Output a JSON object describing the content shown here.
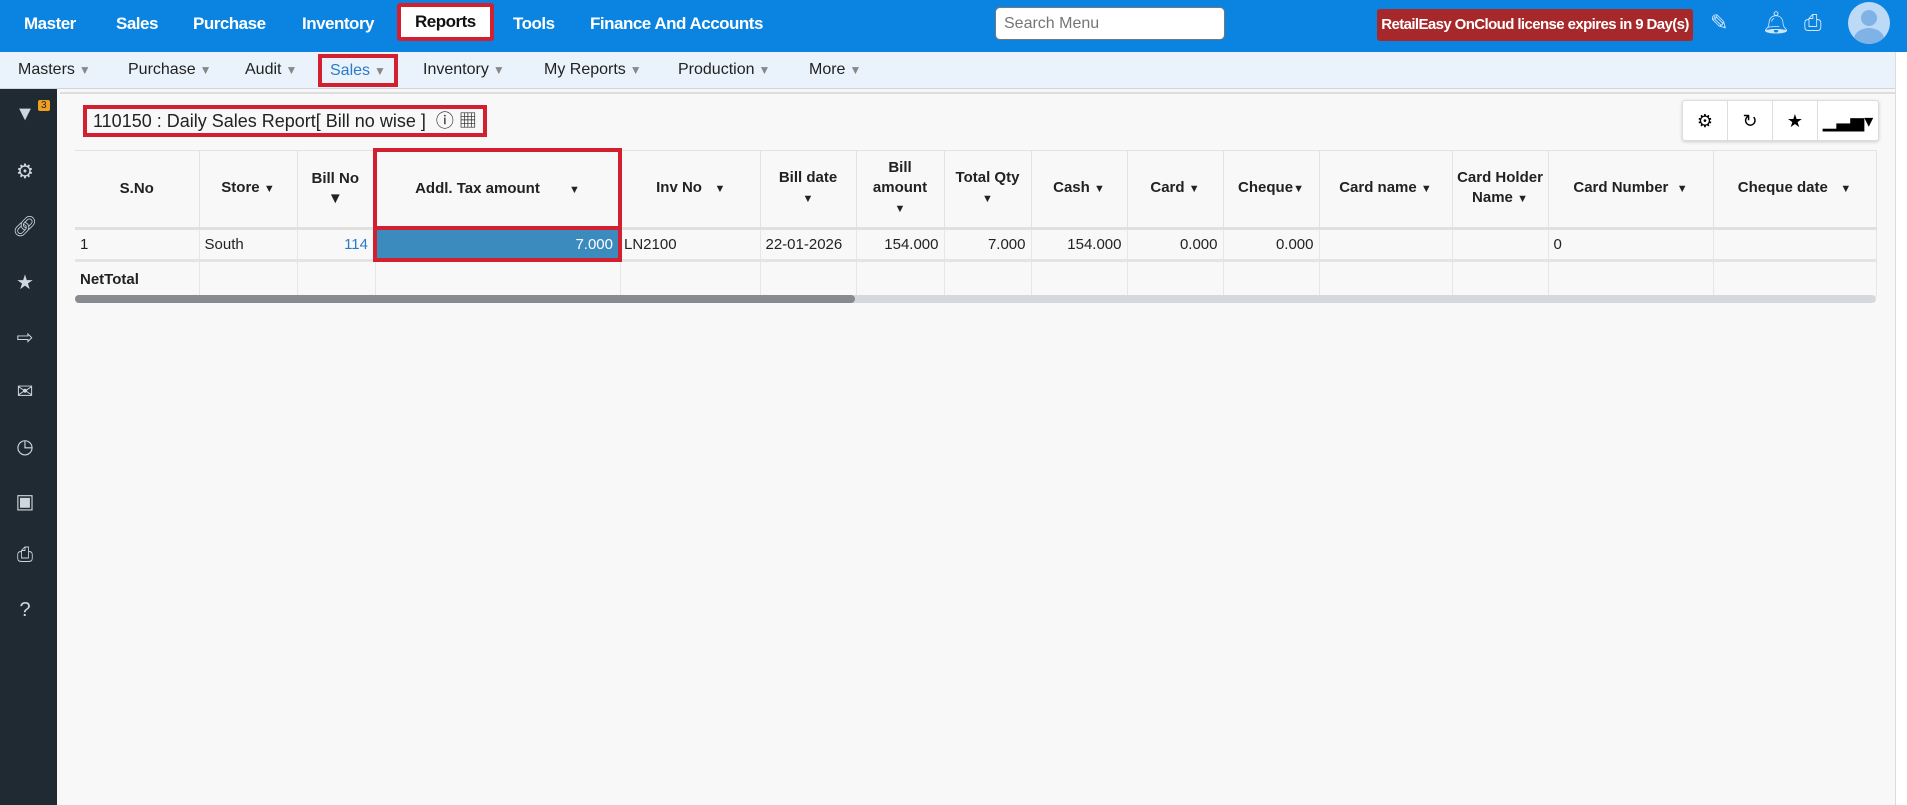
{
  "topnav": [
    "Master",
    "Sales",
    "Purchase",
    "Inventory",
    "Reports",
    "Tools",
    "Finance And Accounts"
  ],
  "search": {
    "placeholder": "Search Menu"
  },
  "license": "RetailEasy OnCloud license expires in 9 Day(s)",
  "subnav": [
    "Masters",
    "Purchase",
    "Audit",
    "Sales",
    "Inventory",
    "My Reports",
    "Production",
    "More"
  ],
  "filter_badge": "3",
  "title": "110150 : Daily Sales Report[ Bill no wise ]",
  "columns": [
    "S.No",
    "Store",
    "Bill No",
    "Addl. Tax amount",
    "Inv No",
    "Bill date",
    "Bill amount",
    "Total Qty",
    "Cash",
    "Card",
    "Cheque",
    "Card name",
    "Card Holder Name",
    "Card Number",
    "Cheque date"
  ],
  "rows": [
    [
      "1",
      "South",
      "114",
      "7.000",
      "LN2100",
      "22-01-2026",
      "154.000",
      "7.000",
      "154.000",
      "0.000",
      "0.000",
      "",
      "",
      "0",
      ""
    ]
  ],
  "net_total_label": "NetTotal"
}
